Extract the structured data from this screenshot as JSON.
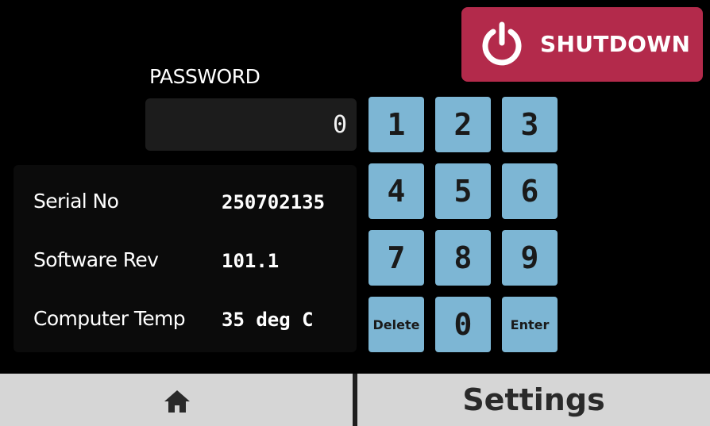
{
  "shutdown": {
    "label": "SHUTDOWN",
    "icon": "power-icon",
    "color": "#b32a4b"
  },
  "password": {
    "label": "PASSWORD",
    "value": "0"
  },
  "info": {
    "rows": [
      {
        "key": "Serial No",
        "value": "250702135"
      },
      {
        "key": "Software Rev",
        "value": "101.1"
      },
      {
        "key": "Computer Temp",
        "value": "35 deg C"
      }
    ]
  },
  "keypad": {
    "color": "#7db6d4",
    "keys": [
      "1",
      "2",
      "3",
      "4",
      "5",
      "6",
      "7",
      "8",
      "9",
      "Delete",
      "0",
      "Enter"
    ]
  },
  "bottom_bar": {
    "home_icon": "home-icon",
    "settings_label": "Settings"
  }
}
